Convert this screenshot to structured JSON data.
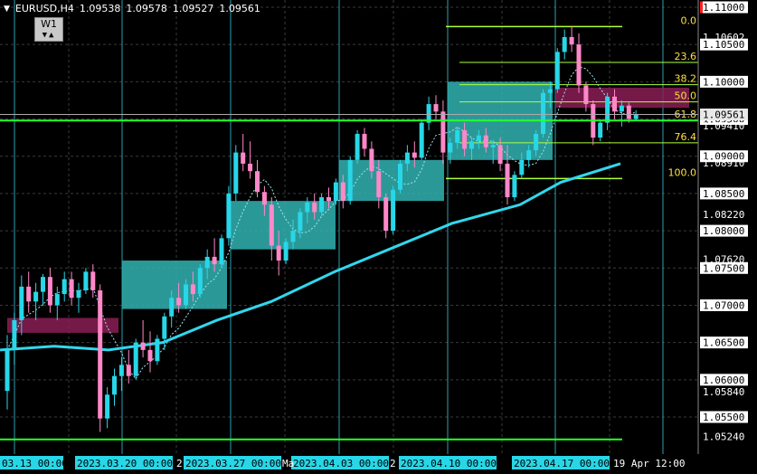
{
  "symbol_info": {
    "symbol": "EURUSD,H4",
    "open": "1.09538",
    "high": "1.09578",
    "low": "1.09527",
    "close": "1.09561"
  },
  "timeframe_widget": {
    "label": "W1",
    "arrows": "▼▲"
  },
  "colors": {
    "background": "#000000",
    "grid": "#3a3a3a",
    "candle_up": "#27d7e8",
    "candle_down": "#ff88c9",
    "ma_fast": "#9ee8f2",
    "ma_slow": "#31d7ee",
    "zone_cyan": "#33b3b3",
    "zone_magenta": "#8a1f55",
    "fib_line": "#b0ff3c",
    "fib_text": "#ffe040",
    "green_line": "#24ff2a",
    "price_label_bg": "#ffffff",
    "current_price_bg": "#e8e8e8",
    "red_marker": "#ff2020"
  },
  "price_axis": {
    "labels": [
      "1.11000",
      "1.10500",
      "1.10000",
      "1.09500",
      "1.09000",
      "1.08500",
      "1.08000",
      "1.07500",
      "1.07000",
      "1.06500",
      "1.06000",
      "1.05500"
    ],
    "special_labels": [
      {
        "text": "1.10602",
        "price": 1.10602,
        "white": false
      },
      {
        "text": "1.09561",
        "price": 1.09561,
        "white": true
      },
      {
        "text": "1.09410",
        "price": 1.0941,
        "white": false
      },
      {
        "text": "1.08910",
        "price": 1.0891,
        "white": false
      },
      {
        "text": "1.08220",
        "price": 1.0822,
        "white": false
      },
      {
        "text": "1.07620",
        "price": 1.0762,
        "white": false
      },
      {
        "text": "1.05840",
        "price": 1.0584,
        "white": false
      },
      {
        "text": "1.05240",
        "price": 1.0524,
        "white": false
      }
    ]
  },
  "time_axis": {
    "labels": [
      "03.13 00:00",
      "2023.03.20 00:00",
      "2023.03.27 00:00",
      "2023.04.03 00:00",
      "2023.04.10 00:00",
      "2023.04.17 00:00",
      "19 Apr 12:00"
    ],
    "fragments": [
      "2",
      "Ma",
      "2"
    ]
  },
  "fibonacci": {
    "levels": [
      {
        "label": "0.0",
        "price": 1.1074
      },
      {
        "label": "23.6",
        "price": 1.1026
      },
      {
        "label": "38.2",
        "price": 1.0996
      },
      {
        "label": "50.0",
        "price": 1.0973
      },
      {
        "label": "61.8",
        "price": 1.0948
      },
      {
        "label": "76.4",
        "price": 1.0918
      },
      {
        "label": "100.0",
        "price": 1.087
      }
    ]
  },
  "chart_data": {
    "type": "candlestick",
    "title": "",
    "price_range": [
      1.052,
      1.1115
    ],
    "bars": [
      [
        1.0585,
        1.066,
        1.056,
        1.064
      ],
      [
        1.064,
        1.069,
        1.062,
        1.068
      ],
      [
        1.068,
        1.074,
        1.066,
        1.0725
      ],
      [
        1.0725,
        1.0745,
        1.069,
        1.0705
      ],
      [
        1.0705,
        1.073,
        1.068,
        1.0718
      ],
      [
        1.0718,
        1.0742,
        1.07,
        1.0738
      ],
      [
        1.0738,
        1.075,
        1.069,
        1.07
      ],
      [
        1.07,
        1.0725,
        1.068,
        1.0715
      ],
      [
        1.0715,
        1.0745,
        1.0705,
        1.0735
      ],
      [
        1.0735,
        1.0745,
        1.07,
        1.071
      ],
      [
        1.071,
        1.073,
        1.069,
        1.072
      ],
      [
        1.072,
        1.075,
        1.0715,
        1.0745
      ],
      [
        1.0745,
        1.0755,
        1.071,
        1.072
      ],
      [
        1.072,
        1.0728,
        1.053,
        1.0548
      ],
      [
        1.0548,
        1.059,
        1.0535,
        1.058
      ],
      [
        1.058,
        1.0615,
        1.0565,
        1.0605
      ],
      [
        1.0605,
        1.063,
        1.0585,
        1.062
      ],
      [
        1.062,
        1.064,
        1.0595,
        1.0605
      ],
      [
        1.0605,
        1.0655,
        1.06,
        1.065
      ],
      [
        1.065,
        1.068,
        1.063,
        1.064
      ],
      [
        1.064,
        1.0665,
        1.061,
        1.0625
      ],
      [
        1.0625,
        1.066,
        1.062,
        1.0655
      ],
      [
        1.0655,
        1.069,
        1.064,
        1.0685
      ],
      [
        1.0685,
        1.072,
        1.067,
        1.071
      ],
      [
        1.071,
        1.073,
        1.069,
        1.07
      ],
      [
        1.07,
        1.0735,
        1.0695,
        1.0728
      ],
      [
        1.0728,
        1.0745,
        1.0705,
        1.0715
      ],
      [
        1.0715,
        1.0755,
        1.071,
        1.075
      ],
      [
        1.075,
        1.0775,
        1.0735,
        1.0765
      ],
      [
        1.0765,
        1.079,
        1.0745,
        1.0755
      ],
      [
        1.0755,
        1.0795,
        1.075,
        1.079
      ],
      [
        1.079,
        1.086,
        1.078,
        1.085
      ],
      [
        1.085,
        1.0915,
        1.084,
        1.0905
      ],
      [
        1.0905,
        1.093,
        1.088,
        1.089
      ],
      [
        1.089,
        1.092,
        1.087,
        1.088
      ],
      [
        1.088,
        1.0895,
        1.0845,
        1.0852
      ],
      [
        1.0852,
        1.086,
        1.082,
        1.0835
      ],
      [
        1.0835,
        1.0845,
        1.076,
        1.078
      ],
      [
        1.078,
        1.08,
        1.074,
        1.076
      ],
      [
        1.076,
        1.079,
        1.0755,
        1.0785
      ],
      [
        1.0785,
        1.0815,
        1.0775,
        1.08
      ],
      [
        1.08,
        1.083,
        1.079,
        1.0825
      ],
      [
        1.0825,
        1.0845,
        1.081,
        1.0838
      ],
      [
        1.0838,
        1.085,
        1.0815,
        1.0825
      ],
      [
        1.0825,
        1.085,
        1.082,
        1.0845
      ],
      [
        1.0845,
        1.0858,
        1.083,
        1.084
      ],
      [
        1.084,
        1.087,
        1.0835,
        1.0865
      ],
      [
        1.0865,
        1.0875,
        1.083,
        1.084
      ],
      [
        1.084,
        1.09,
        1.0835,
        1.0895
      ],
      [
        1.0895,
        1.0935,
        1.089,
        1.093
      ],
      [
        1.093,
        1.0938,
        1.09,
        1.091
      ],
      [
        1.091,
        1.092,
        1.087,
        1.088
      ],
      [
        1.088,
        1.0895,
        1.083,
        1.0845
      ],
      [
        1.0845,
        1.085,
        1.079,
        1.08
      ],
      [
        1.08,
        1.086,
        1.0795,
        1.0855
      ],
      [
        1.0855,
        1.0895,
        1.085,
        1.089
      ],
      [
        1.089,
        1.0915,
        1.088,
        1.0905
      ],
      [
        1.0905,
        1.092,
        1.0885,
        1.0898
      ],
      [
        1.0898,
        1.095,
        1.0895,
        1.0945
      ],
      [
        1.0945,
        1.098,
        1.0935,
        1.097
      ],
      [
        1.097,
        1.0982,
        1.095,
        1.096
      ],
      [
        1.096,
        1.0975,
        1.089,
        1.0905
      ],
      [
        1.0905,
        1.0925,
        1.089,
        1.0918
      ],
      [
        1.0918,
        1.094,
        1.091,
        1.0935
      ],
      [
        1.0935,
        1.0945,
        1.09,
        1.091
      ],
      [
        1.091,
        1.0925,
        1.0895,
        1.092
      ],
      [
        1.092,
        1.0935,
        1.091,
        1.0928
      ],
      [
        1.0928,
        1.0938,
        1.0905,
        1.0912
      ],
      [
        1.0912,
        1.0922,
        1.089,
        1.0915
      ],
      [
        1.0915,
        1.0925,
        1.088,
        1.089
      ],
      [
        1.089,
        1.0915,
        1.0835,
        1.0845
      ],
      [
        1.0845,
        1.088,
        1.084,
        1.0875
      ],
      [
        1.0875,
        1.0905,
        1.087,
        1.0895
      ],
      [
        1.0895,
        1.0915,
        1.0885,
        1.0908
      ],
      [
        1.0908,
        1.0935,
        1.09,
        1.093
      ],
      [
        1.093,
        1.099,
        1.0925,
        1.0985
      ],
      [
        1.0985,
        1.1,
        1.0965,
        1.099
      ],
      [
        1.099,
        1.1045,
        1.0985,
        1.104
      ],
      [
        1.104,
        1.107,
        1.103,
        1.106
      ],
      [
        1.106,
        1.1075,
        1.104,
        1.105
      ],
      [
        1.105,
        1.1065,
        1.0985,
        1.0995
      ],
      [
        1.0995,
        1.1,
        1.096,
        1.097
      ],
      [
        1.097,
        1.0975,
        1.0915,
        1.0925
      ],
      [
        1.0925,
        1.095,
        1.092,
        1.0945
      ],
      [
        1.0945,
        1.0985,
        1.0935,
        1.098
      ],
      [
        1.098,
        1.099,
        1.095,
        1.096
      ],
      [
        1.096,
        1.0975,
        1.094,
        1.0968
      ],
      [
        1.0968,
        1.0972,
        1.0945,
        1.095
      ],
      [
        1.095,
        1.0962,
        1.0948,
        1.0956
      ]
    ]
  }
}
